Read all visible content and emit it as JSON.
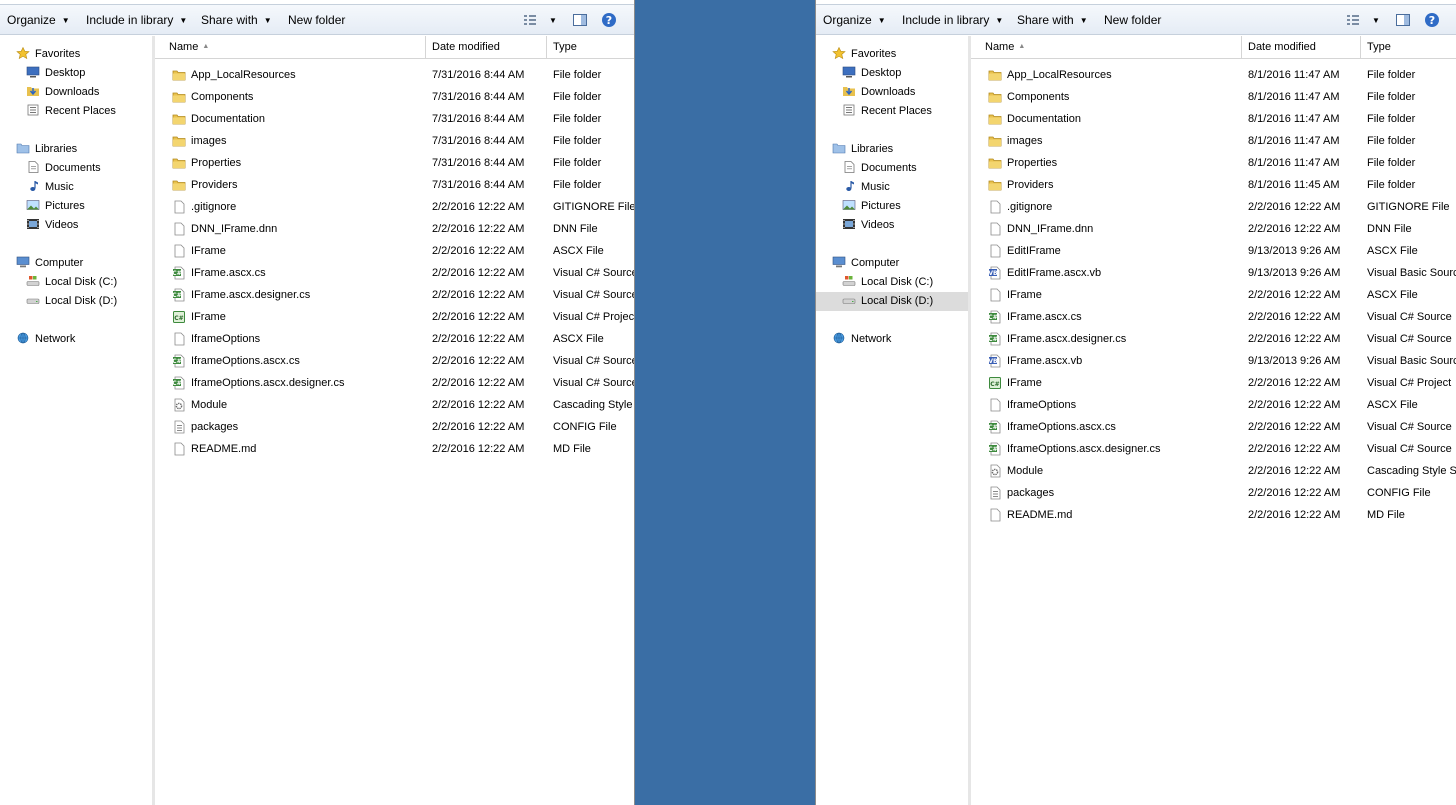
{
  "toolbar": {
    "organize": "Organize",
    "include_in_library": "Include in library",
    "share_with": "Share with",
    "new_folder": "New folder"
  },
  "icons": {
    "folder": "folder-icon",
    "file": "file-icon",
    "cs": "csharp-file-icon",
    "vb": "vb-file-icon",
    "project": "project-file-icon",
    "config": "config-file-icon",
    "module": "gear-file-icon"
  },
  "colors": {
    "desktop_bg": "#3a6ea5",
    "folder": "#e8c14e",
    "toolbar_bg": "#e9eff7",
    "nav_selected": "#dcdcdc"
  },
  "nav": {
    "favorites": "Favorites",
    "desktop": "Desktop",
    "downloads": "Downloads",
    "recent_places": "Recent Places",
    "libraries": "Libraries",
    "documents": "Documents",
    "music": "Music",
    "pictures": "Pictures",
    "videos": "Videos",
    "computer": "Computer",
    "local_c": "Local Disk (C:)",
    "local_d": "Local Disk (D:)",
    "network": "Network"
  },
  "columns": {
    "name": "Name",
    "date_modified": "Date modified",
    "type": "Type"
  },
  "left_window": {
    "selected_nav": "",
    "files": [
      {
        "name": "App_LocalResources",
        "date": "7/31/2016 8:44 AM",
        "type": "File folder",
        "icon": "folder"
      },
      {
        "name": "Components",
        "date": "7/31/2016 8:44 AM",
        "type": "File folder",
        "icon": "folder"
      },
      {
        "name": "Documentation",
        "date": "7/31/2016 8:44 AM",
        "type": "File folder",
        "icon": "folder"
      },
      {
        "name": "images",
        "date": "7/31/2016 8:44 AM",
        "type": "File folder",
        "icon": "folder"
      },
      {
        "name": "Properties",
        "date": "7/31/2016 8:44 AM",
        "type": "File folder",
        "icon": "folder"
      },
      {
        "name": "Providers",
        "date": "7/31/2016 8:44 AM",
        "type": "File folder",
        "icon": "folder"
      },
      {
        "name": ".gitignore",
        "date": "2/2/2016 12:22 AM",
        "type": "GITIGNORE File",
        "icon": "file"
      },
      {
        "name": "DNN_IFrame.dnn",
        "date": "2/2/2016 12:22 AM",
        "type": "DNN File",
        "icon": "file"
      },
      {
        "name": "IFrame",
        "date": "2/2/2016 12:22 AM",
        "type": "ASCX File",
        "icon": "file"
      },
      {
        "name": "IFrame.ascx.cs",
        "date": "2/2/2016 12:22 AM",
        "type": "Visual C# Source",
        "icon": "cs"
      },
      {
        "name": "IFrame.ascx.designer.cs",
        "date": "2/2/2016 12:22 AM",
        "type": "Visual C# Source",
        "icon": "cs"
      },
      {
        "name": "IFrame",
        "date": "2/2/2016 12:22 AM",
        "type": "Visual C# Project",
        "icon": "project"
      },
      {
        "name": "IframeOptions",
        "date": "2/2/2016 12:22 AM",
        "type": "ASCX File",
        "icon": "file"
      },
      {
        "name": "IframeOptions.ascx.cs",
        "date": "2/2/2016 12:22 AM",
        "type": "Visual C# Source",
        "icon": "cs"
      },
      {
        "name": "IframeOptions.ascx.designer.cs",
        "date": "2/2/2016 12:22 AM",
        "type": "Visual C# Source",
        "icon": "cs"
      },
      {
        "name": "Module",
        "date": "2/2/2016 12:22 AM",
        "type": "Cascading Style S",
        "icon": "module"
      },
      {
        "name": "packages",
        "date": "2/2/2016 12:22 AM",
        "type": "CONFIG File",
        "icon": "config"
      },
      {
        "name": "README.md",
        "date": "2/2/2016 12:22 AM",
        "type": "MD File",
        "icon": "file"
      }
    ]
  },
  "right_window": {
    "selected_nav": "local_d",
    "files": [
      {
        "name": "App_LocalResources",
        "date": "8/1/2016 11:47 AM",
        "type": "File folder",
        "icon": "folder"
      },
      {
        "name": "Components",
        "date": "8/1/2016 11:47 AM",
        "type": "File folder",
        "icon": "folder"
      },
      {
        "name": "Documentation",
        "date": "8/1/2016 11:47 AM",
        "type": "File folder",
        "icon": "folder"
      },
      {
        "name": "images",
        "date": "8/1/2016 11:47 AM",
        "type": "File folder",
        "icon": "folder"
      },
      {
        "name": "Properties",
        "date": "8/1/2016 11:47 AM",
        "type": "File folder",
        "icon": "folder"
      },
      {
        "name": "Providers",
        "date": "8/1/2016 11:45 AM",
        "type": "File folder",
        "icon": "folder"
      },
      {
        "name": ".gitignore",
        "date": "2/2/2016 12:22 AM",
        "type": "GITIGNORE File",
        "icon": "file"
      },
      {
        "name": "DNN_IFrame.dnn",
        "date": "2/2/2016 12:22 AM",
        "type": "DNN File",
        "icon": "file"
      },
      {
        "name": "EditIFrame",
        "date": "9/13/2013 9:26 AM",
        "type": "ASCX File",
        "icon": "file"
      },
      {
        "name": "EditIFrame.ascx.vb",
        "date": "9/13/2013 9:26 AM",
        "type": "Visual Basic Sourc",
        "icon": "vb"
      },
      {
        "name": "IFrame",
        "date": "2/2/2016 12:22 AM",
        "type": "ASCX File",
        "icon": "file"
      },
      {
        "name": "IFrame.ascx.cs",
        "date": "2/2/2016 12:22 AM",
        "type": "Visual C# Source",
        "icon": "cs"
      },
      {
        "name": "IFrame.ascx.designer.cs",
        "date": "2/2/2016 12:22 AM",
        "type": "Visual C# Source",
        "icon": "cs"
      },
      {
        "name": "IFrame.ascx.vb",
        "date": "9/13/2013 9:26 AM",
        "type": "Visual Basic Sourc",
        "icon": "vb"
      },
      {
        "name": "IFrame",
        "date": "2/2/2016 12:22 AM",
        "type": "Visual C# Project",
        "icon": "project"
      },
      {
        "name": "IframeOptions",
        "date": "2/2/2016 12:22 AM",
        "type": "ASCX File",
        "icon": "file"
      },
      {
        "name": "IframeOptions.ascx.cs",
        "date": "2/2/2016 12:22 AM",
        "type": "Visual C# Source",
        "icon": "cs"
      },
      {
        "name": "IframeOptions.ascx.designer.cs",
        "date": "2/2/2016 12:22 AM",
        "type": "Visual C# Source",
        "icon": "cs"
      },
      {
        "name": "Module",
        "date": "2/2/2016 12:22 AM",
        "type": "Cascading Style S",
        "icon": "module"
      },
      {
        "name": "packages",
        "date": "2/2/2016 12:22 AM",
        "type": "CONFIG File",
        "icon": "config"
      },
      {
        "name": "README.md",
        "date": "2/2/2016 12:22 AM",
        "type": "MD File",
        "icon": "file"
      }
    ]
  }
}
